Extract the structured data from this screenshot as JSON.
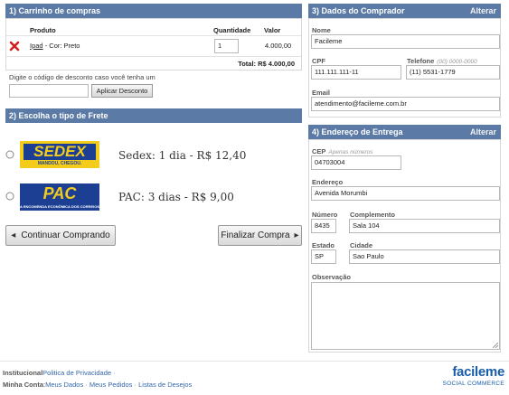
{
  "cart": {
    "header": "1) Carrinho de compras",
    "col_product": "Produto",
    "col_quantity": "Quantidade",
    "col_value": "Valor",
    "item": {
      "product_link": "Ipad",
      "product_desc": " - Cor: Preto",
      "quantity": "1",
      "value": "4.000,00"
    },
    "total": "Total: R$ 4.000,00",
    "discount_label": "Digite o código de desconto caso você tenha um",
    "discount_value": "",
    "discount_button": "Aplicar Desconto"
  },
  "freight": {
    "header": "2) Escolha o tipo de Frete",
    "options": [
      {
        "logo_text": "SEDEX",
        "logo_sub": "MANDOU, CHEGOU.",
        "service": "Sedex",
        "delivery": "1 dia",
        "price": "R$ 12,40"
      },
      {
        "logo_text": "PAC",
        "logo_sub": "A ENCOMENDA ECONÔMICA DOS CORREIOS",
        "service": "PAC",
        "delivery": "3 dias",
        "price": "R$ 9,00"
      }
    ],
    "continue_button": "Continuar Comprando",
    "finish_button": "Finalizar Compra",
    "arrow_left": "◂",
    "arrow_right": "▸"
  },
  "buyer": {
    "header": "3) Dados do Comprador",
    "edit_link": "Alterar",
    "name_label": "Nome",
    "name_value": "Facileme",
    "cpf_label": "CPF",
    "cpf_value": "111.111.111-11",
    "phone_label": "Telefone",
    "phone_hint": "(00) 0000-0000",
    "phone_value": "(11) 5531-1779",
    "email_label": "Email",
    "email_value": "atendimento@facileme.com.br"
  },
  "address": {
    "header": "4) Endereço de Entrega",
    "edit_link": "Alterar",
    "cep_label": "CEP",
    "cep_hint": "Apenas números",
    "cep_value": "04703004",
    "street_label": "Endereço",
    "street_value": "Avenida Morumbi",
    "number_label": "Número",
    "number_value": "8435",
    "complement_label": "Complemento",
    "complement_value": "Sala 104",
    "state_label": "Estado",
    "state_value": "SP",
    "city_label": "Cidade",
    "city_value": "Sao Paulo",
    "notes_label": "Observação",
    "notes_value": ""
  },
  "footer": {
    "institutional_label": "Institucional",
    "privacy_link": "Politica de Privacidade",
    "account_label": "Minha Conta",
    "my_data_link": "Meus Dados",
    "my_orders_link": "Meus Pedidos",
    "wishlist_link": "Listas de Desejos",
    "separator": "·",
    "brand_name": "facileme",
    "brand_tag": "SOCIAL COMMERCE"
  },
  "colors": {
    "header_bg": "#5b7aa6",
    "sedex_yellow": "#f4cc1c",
    "sedex_blue": "#1c3f94",
    "pac_blue": "#1c3f94",
    "brand_blue": "#1a5da8"
  },
  "icons": {
    "remove": "close-icon",
    "radio": "radio-icon"
  }
}
